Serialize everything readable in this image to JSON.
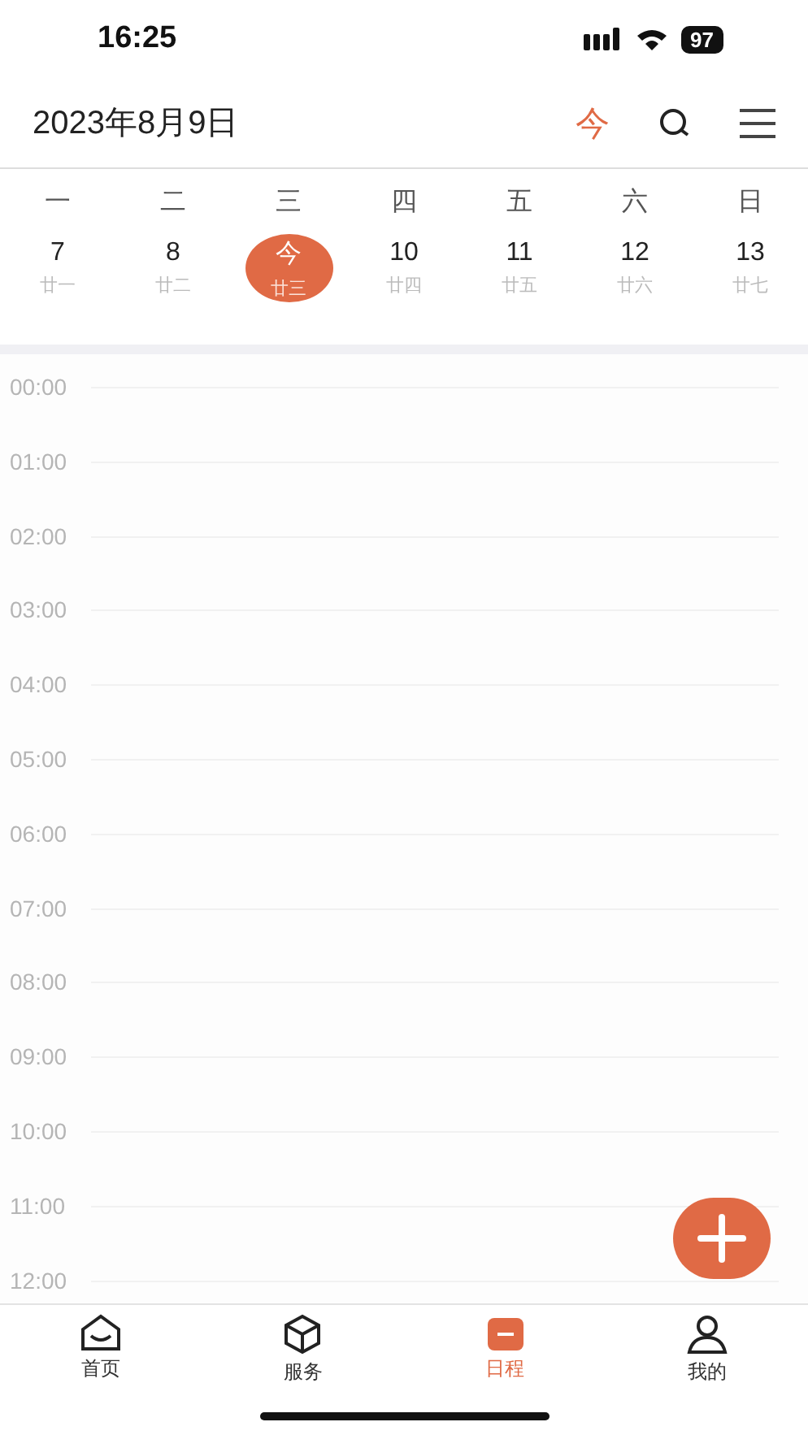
{
  "status_bar": {
    "time": "16:25",
    "battery": "97"
  },
  "header": {
    "title": "2023年8月9日",
    "today_button": "今"
  },
  "weekdays": [
    "一",
    "二",
    "三",
    "四",
    "五",
    "六",
    "日"
  ],
  "days": [
    {
      "day": "7",
      "lunar": "廿一",
      "selected": false
    },
    {
      "day": "8",
      "lunar": "廿二",
      "selected": false
    },
    {
      "day": "今",
      "lunar": "廿三",
      "selected": true
    },
    {
      "day": "10",
      "lunar": "廿四",
      "selected": false
    },
    {
      "day": "11",
      "lunar": "廿五",
      "selected": false
    },
    {
      "day": "12",
      "lunar": "廿六",
      "selected": false
    },
    {
      "day": "13",
      "lunar": "廿七",
      "selected": false
    }
  ],
  "hours": [
    "00:00",
    "01:00",
    "02:00",
    "03:00",
    "04:00",
    "05:00",
    "06:00",
    "07:00",
    "08:00",
    "09:00",
    "10:00",
    "11:00",
    "12:00"
  ],
  "tab_bar": [
    {
      "label": "首页",
      "kind": "home",
      "selected": false
    },
    {
      "label": "服务",
      "kind": "service",
      "selected": false
    },
    {
      "label": "日程",
      "kind": "schedule",
      "selected": true
    },
    {
      "label": "我的",
      "kind": "profile",
      "selected": false
    }
  ]
}
